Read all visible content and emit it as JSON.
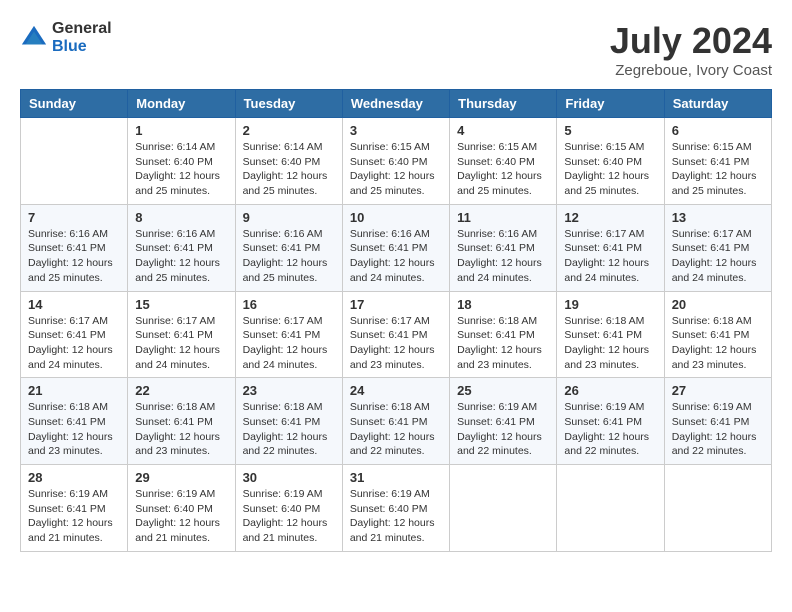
{
  "header": {
    "logo_general": "General",
    "logo_blue": "Blue",
    "month_year": "July 2024",
    "location": "Zegreboue, Ivory Coast"
  },
  "calendar": {
    "days_of_week": [
      "Sunday",
      "Monday",
      "Tuesday",
      "Wednesday",
      "Thursday",
      "Friday",
      "Saturday"
    ],
    "weeks": [
      [
        {
          "day": "",
          "info": ""
        },
        {
          "day": "1",
          "info": "Sunrise: 6:14 AM\nSunset: 6:40 PM\nDaylight: 12 hours\nand 25 minutes."
        },
        {
          "day": "2",
          "info": "Sunrise: 6:14 AM\nSunset: 6:40 PM\nDaylight: 12 hours\nand 25 minutes."
        },
        {
          "day": "3",
          "info": "Sunrise: 6:15 AM\nSunset: 6:40 PM\nDaylight: 12 hours\nand 25 minutes."
        },
        {
          "day": "4",
          "info": "Sunrise: 6:15 AM\nSunset: 6:40 PM\nDaylight: 12 hours\nand 25 minutes."
        },
        {
          "day": "5",
          "info": "Sunrise: 6:15 AM\nSunset: 6:40 PM\nDaylight: 12 hours\nand 25 minutes."
        },
        {
          "day": "6",
          "info": "Sunrise: 6:15 AM\nSunset: 6:41 PM\nDaylight: 12 hours\nand 25 minutes."
        }
      ],
      [
        {
          "day": "7",
          "info": "Sunrise: 6:16 AM\nSunset: 6:41 PM\nDaylight: 12 hours\nand 25 minutes."
        },
        {
          "day": "8",
          "info": "Sunrise: 6:16 AM\nSunset: 6:41 PM\nDaylight: 12 hours\nand 25 minutes."
        },
        {
          "day": "9",
          "info": "Sunrise: 6:16 AM\nSunset: 6:41 PM\nDaylight: 12 hours\nand 25 minutes."
        },
        {
          "day": "10",
          "info": "Sunrise: 6:16 AM\nSunset: 6:41 PM\nDaylight: 12 hours\nand 24 minutes."
        },
        {
          "day": "11",
          "info": "Sunrise: 6:16 AM\nSunset: 6:41 PM\nDaylight: 12 hours\nand 24 minutes."
        },
        {
          "day": "12",
          "info": "Sunrise: 6:17 AM\nSunset: 6:41 PM\nDaylight: 12 hours\nand 24 minutes."
        },
        {
          "day": "13",
          "info": "Sunrise: 6:17 AM\nSunset: 6:41 PM\nDaylight: 12 hours\nand 24 minutes."
        }
      ],
      [
        {
          "day": "14",
          "info": "Sunrise: 6:17 AM\nSunset: 6:41 PM\nDaylight: 12 hours\nand 24 minutes."
        },
        {
          "day": "15",
          "info": "Sunrise: 6:17 AM\nSunset: 6:41 PM\nDaylight: 12 hours\nand 24 minutes."
        },
        {
          "day": "16",
          "info": "Sunrise: 6:17 AM\nSunset: 6:41 PM\nDaylight: 12 hours\nand 24 minutes."
        },
        {
          "day": "17",
          "info": "Sunrise: 6:17 AM\nSunset: 6:41 PM\nDaylight: 12 hours\nand 23 minutes."
        },
        {
          "day": "18",
          "info": "Sunrise: 6:18 AM\nSunset: 6:41 PM\nDaylight: 12 hours\nand 23 minutes."
        },
        {
          "day": "19",
          "info": "Sunrise: 6:18 AM\nSunset: 6:41 PM\nDaylight: 12 hours\nand 23 minutes."
        },
        {
          "day": "20",
          "info": "Sunrise: 6:18 AM\nSunset: 6:41 PM\nDaylight: 12 hours\nand 23 minutes."
        }
      ],
      [
        {
          "day": "21",
          "info": "Sunrise: 6:18 AM\nSunset: 6:41 PM\nDaylight: 12 hours\nand 23 minutes."
        },
        {
          "day": "22",
          "info": "Sunrise: 6:18 AM\nSunset: 6:41 PM\nDaylight: 12 hours\nand 23 minutes."
        },
        {
          "day": "23",
          "info": "Sunrise: 6:18 AM\nSunset: 6:41 PM\nDaylight: 12 hours\nand 22 minutes."
        },
        {
          "day": "24",
          "info": "Sunrise: 6:18 AM\nSunset: 6:41 PM\nDaylight: 12 hours\nand 22 minutes."
        },
        {
          "day": "25",
          "info": "Sunrise: 6:19 AM\nSunset: 6:41 PM\nDaylight: 12 hours\nand 22 minutes."
        },
        {
          "day": "26",
          "info": "Sunrise: 6:19 AM\nSunset: 6:41 PM\nDaylight: 12 hours\nand 22 minutes."
        },
        {
          "day": "27",
          "info": "Sunrise: 6:19 AM\nSunset: 6:41 PM\nDaylight: 12 hours\nand 22 minutes."
        }
      ],
      [
        {
          "day": "28",
          "info": "Sunrise: 6:19 AM\nSunset: 6:41 PM\nDaylight: 12 hours\nand 21 minutes."
        },
        {
          "day": "29",
          "info": "Sunrise: 6:19 AM\nSunset: 6:40 PM\nDaylight: 12 hours\nand 21 minutes."
        },
        {
          "day": "30",
          "info": "Sunrise: 6:19 AM\nSunset: 6:40 PM\nDaylight: 12 hours\nand 21 minutes."
        },
        {
          "day": "31",
          "info": "Sunrise: 6:19 AM\nSunset: 6:40 PM\nDaylight: 12 hours\nand 21 minutes."
        },
        {
          "day": "",
          "info": ""
        },
        {
          "day": "",
          "info": ""
        },
        {
          "day": "",
          "info": ""
        }
      ]
    ]
  }
}
